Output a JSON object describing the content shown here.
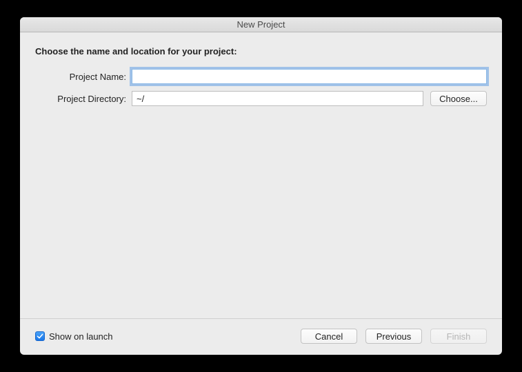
{
  "titlebar": {
    "title": "New Project"
  },
  "heading": "Choose the name and location for your project:",
  "form": {
    "project_name_label": "Project Name:",
    "project_name_value": "",
    "project_dir_label": "Project Directory:",
    "project_dir_value": "~/",
    "choose_label": "Choose..."
  },
  "footer": {
    "show_on_launch_label": "Show on launch",
    "show_on_launch_checked": true,
    "cancel_label": "Cancel",
    "previous_label": "Previous",
    "finish_label": "Finish"
  }
}
